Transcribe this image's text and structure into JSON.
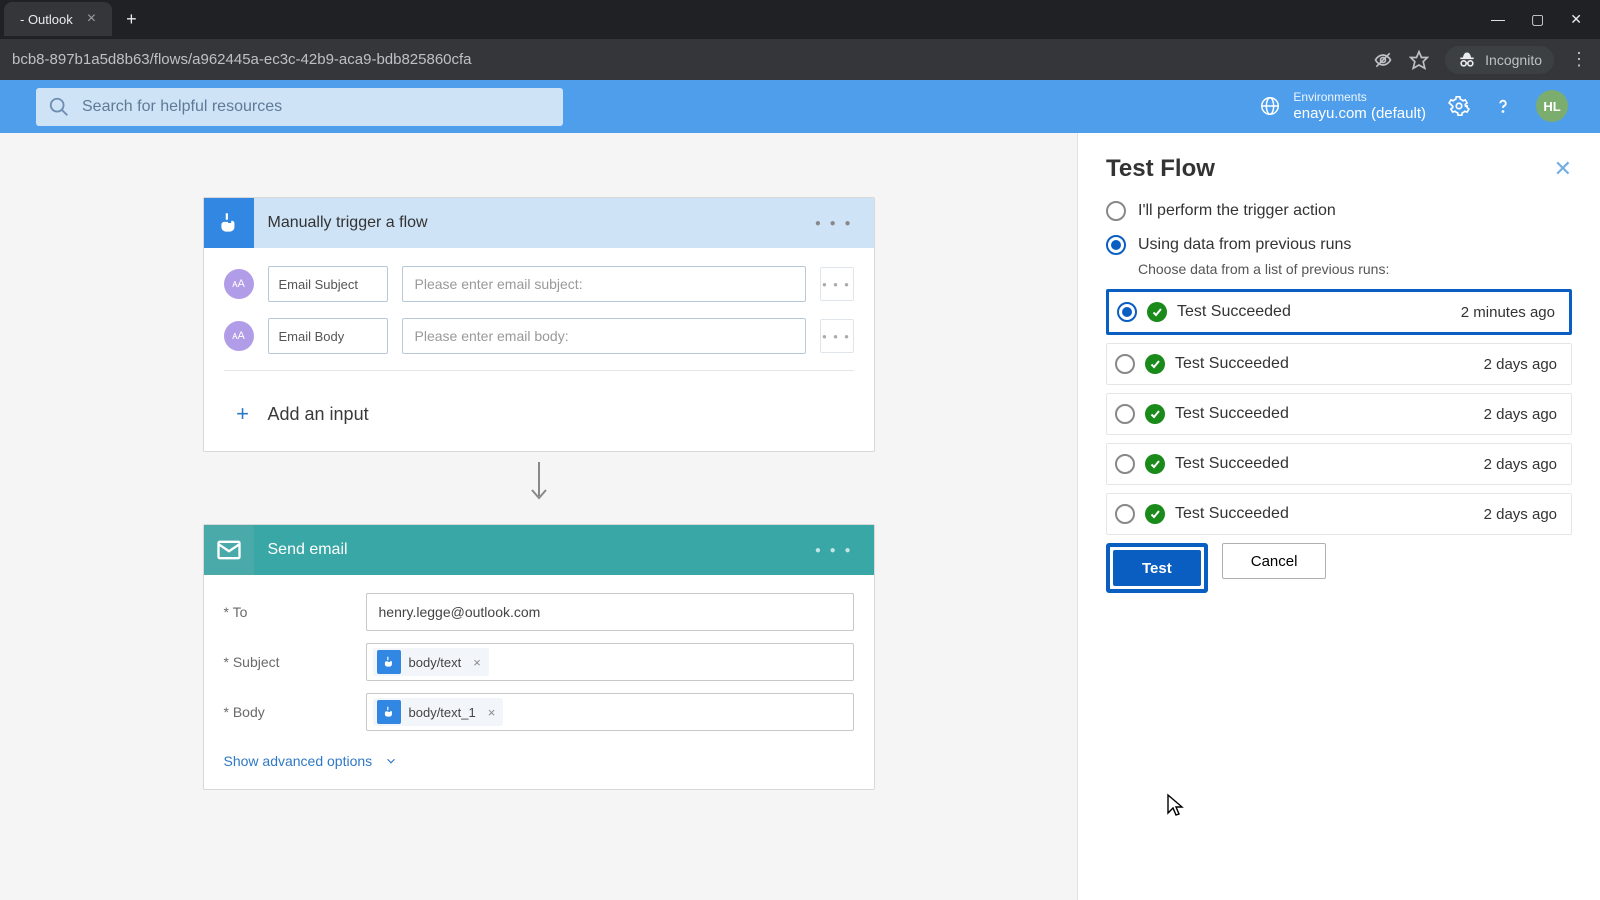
{
  "browser": {
    "tab_title": " - Outlook",
    "address": "bcb8-897b1a5d8b63/flows/a962445a-ec3c-42b9-aca9-bdb825860cfa",
    "incognito_label": "Incognito"
  },
  "app_bar": {
    "search_placeholder": "Search for helpful resources",
    "env_label": "Environments",
    "env_value": "enayu.com (default)",
    "avatar": "HL"
  },
  "trigger_card": {
    "title": "Manually trigger a flow",
    "inputs": [
      {
        "label": "Email Subject",
        "placeholder": "Please enter email subject:"
      },
      {
        "label": "Email Body",
        "placeholder": "Please enter email body:"
      }
    ],
    "add_input": "Add an input"
  },
  "action_card": {
    "title": "Send email",
    "to_label": "* To",
    "to_value": "henry.legge@outlook.com",
    "subject_label": "* Subject",
    "subject_token": "body/text",
    "body_label": "* Body",
    "body_token": "body/text_1",
    "advanced": "Show advanced options"
  },
  "panel": {
    "title": "Test Flow",
    "option_manual": "I'll perform the trigger action",
    "option_prev": "Using data from previous runs",
    "prev_sub": "Choose data from a list of previous runs:",
    "runs": [
      {
        "label": "Test Succeeded",
        "time": "2 minutes ago"
      },
      {
        "label": "Test Succeeded",
        "time": "2 days ago"
      },
      {
        "label": "Test Succeeded",
        "time": "2 days ago"
      },
      {
        "label": "Test Succeeded",
        "time": "2 days ago"
      },
      {
        "label": "Test Succeeded",
        "time": "2 days ago"
      }
    ],
    "btn_test": "Test",
    "btn_cancel": "Cancel"
  }
}
